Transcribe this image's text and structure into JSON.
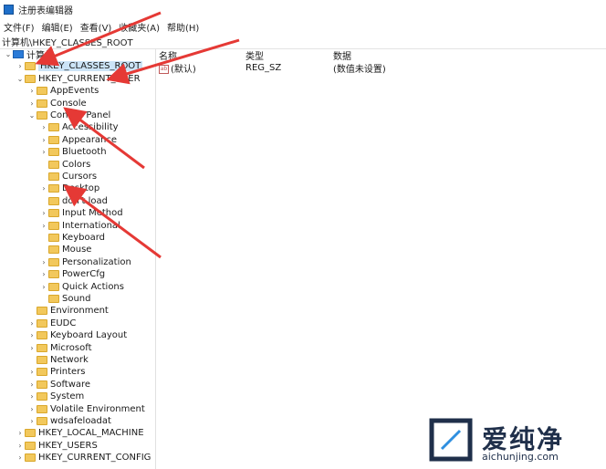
{
  "window": {
    "title": "注册表编辑器"
  },
  "menu": [
    "文件(F)",
    "编辑(E)",
    "查看(V)",
    "收藏夹(A)",
    "帮助(H)"
  ],
  "address": "计算机\\HKEY_CLASSES_ROOT",
  "tree": [
    {
      "label": "计算机",
      "chev": "v",
      "level": 0,
      "icon": "computer-icon"
    },
    {
      "label": "HKEY_CLASSES_ROOT",
      "chev": ">",
      "level": 1,
      "icon": "folder-icon",
      "selected": true
    },
    {
      "label": "HKEY_CURRENT_USER",
      "chev": "v",
      "level": 1,
      "icon": "folder-icon"
    },
    {
      "label": "AppEvents",
      "chev": ">",
      "level": 2,
      "icon": "folder-icon"
    },
    {
      "label": "Console",
      "chev": ">",
      "level": 2,
      "icon": "folder-icon"
    },
    {
      "label": "Control Panel",
      "chev": "v",
      "level": 2,
      "icon": "folder-icon"
    },
    {
      "label": "Accessibility",
      "chev": ">",
      "level": 3,
      "icon": "folder-icon"
    },
    {
      "label": "Appearance",
      "chev": ">",
      "level": 3,
      "icon": "folder-icon"
    },
    {
      "label": "Bluetooth",
      "chev": ">",
      "level": 3,
      "icon": "folder-icon"
    },
    {
      "label": "Colors",
      "chev": "",
      "level": 3,
      "icon": "folder-icon"
    },
    {
      "label": "Cursors",
      "chev": "",
      "level": 3,
      "icon": "folder-icon"
    },
    {
      "label": "Desktop",
      "chev": ">",
      "level": 3,
      "icon": "folder-icon"
    },
    {
      "label": "don't load",
      "chev": "",
      "level": 3,
      "icon": "folder-icon"
    },
    {
      "label": "Input Method",
      "chev": ">",
      "level": 3,
      "icon": "folder-icon"
    },
    {
      "label": "International",
      "chev": ">",
      "level": 3,
      "icon": "folder-icon"
    },
    {
      "label": "Keyboard",
      "chev": "",
      "level": 3,
      "icon": "folder-icon"
    },
    {
      "label": "Mouse",
      "chev": "",
      "level": 3,
      "icon": "folder-icon"
    },
    {
      "label": "Personalization",
      "chev": ">",
      "level": 3,
      "icon": "folder-icon"
    },
    {
      "label": "PowerCfg",
      "chev": ">",
      "level": 3,
      "icon": "folder-icon"
    },
    {
      "label": "Quick Actions",
      "chev": ">",
      "level": 3,
      "icon": "folder-icon"
    },
    {
      "label": "Sound",
      "chev": "",
      "level": 3,
      "icon": "folder-icon"
    },
    {
      "label": "Environment",
      "chev": "",
      "level": 2,
      "icon": "folder-icon"
    },
    {
      "label": "EUDC",
      "chev": ">",
      "level": 2,
      "icon": "folder-icon"
    },
    {
      "label": "Keyboard Layout",
      "chev": ">",
      "level": 2,
      "icon": "folder-icon"
    },
    {
      "label": "Microsoft",
      "chev": ">",
      "level": 2,
      "icon": "folder-icon"
    },
    {
      "label": "Network",
      "chev": "",
      "level": 2,
      "icon": "folder-icon"
    },
    {
      "label": "Printers",
      "chev": ">",
      "level": 2,
      "icon": "folder-icon"
    },
    {
      "label": "Software",
      "chev": ">",
      "level": 2,
      "icon": "folder-icon"
    },
    {
      "label": "System",
      "chev": ">",
      "level": 2,
      "icon": "folder-icon"
    },
    {
      "label": "Volatile Environment",
      "chev": ">",
      "level": 2,
      "icon": "folder-icon"
    },
    {
      "label": "wdsafeloadat",
      "chev": ">",
      "level": 2,
      "icon": "folder-icon"
    },
    {
      "label": "HKEY_LOCAL_MACHINE",
      "chev": ">",
      "level": 1,
      "icon": "folder-icon"
    },
    {
      "label": "HKEY_USERS",
      "chev": ">",
      "level": 1,
      "icon": "folder-icon"
    },
    {
      "label": "HKEY_CURRENT_CONFIG",
      "chev": ">",
      "level": 1,
      "icon": "folder-icon"
    }
  ],
  "list": {
    "headers": {
      "name": "名称",
      "type": "类型",
      "data": "数据"
    },
    "rows": [
      {
        "name": "(默认)",
        "type": "REG_SZ",
        "data": "(数值未设置)",
        "icon": "string-value-icon"
      }
    ]
  },
  "annotation_color": "#e53935",
  "watermark": {
    "name": "爱纯净",
    "url": "aichunjing.com"
  }
}
